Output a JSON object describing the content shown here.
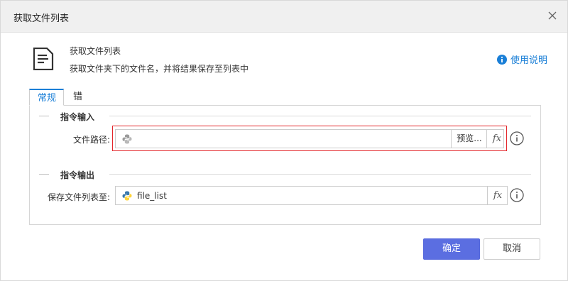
{
  "window": {
    "title": "获取文件列表"
  },
  "header": {
    "command_name": "获取文件列表",
    "command_description": "获取文件夹下的文件名，并将结果保存至列表中",
    "help_label": "使用说明"
  },
  "tabs": [
    {
      "label": "常规",
      "active": true
    },
    {
      "label": "错误处理",
      "active": false
    }
  ],
  "input_section": {
    "title": "指令输入",
    "file_path": {
      "label": "文件路径:",
      "value": "",
      "placeholder": "",
      "browse_label": "预览...",
      "fx_label": "fx"
    }
  },
  "output_section": {
    "title": "指令输出",
    "save_list": {
      "label": "保存文件列表至:",
      "value": "file_list",
      "fx_label": "fx"
    }
  },
  "footer": {
    "ok_label": "确定",
    "cancel_label": "取消"
  },
  "colors": {
    "accent": "#1a7fd7",
    "primary_button": "#5b6ee1",
    "highlight": "#e3262b"
  },
  "icons": [
    "document-icon",
    "info-icon",
    "close-icon",
    "python-icon",
    "fx-icon"
  ]
}
